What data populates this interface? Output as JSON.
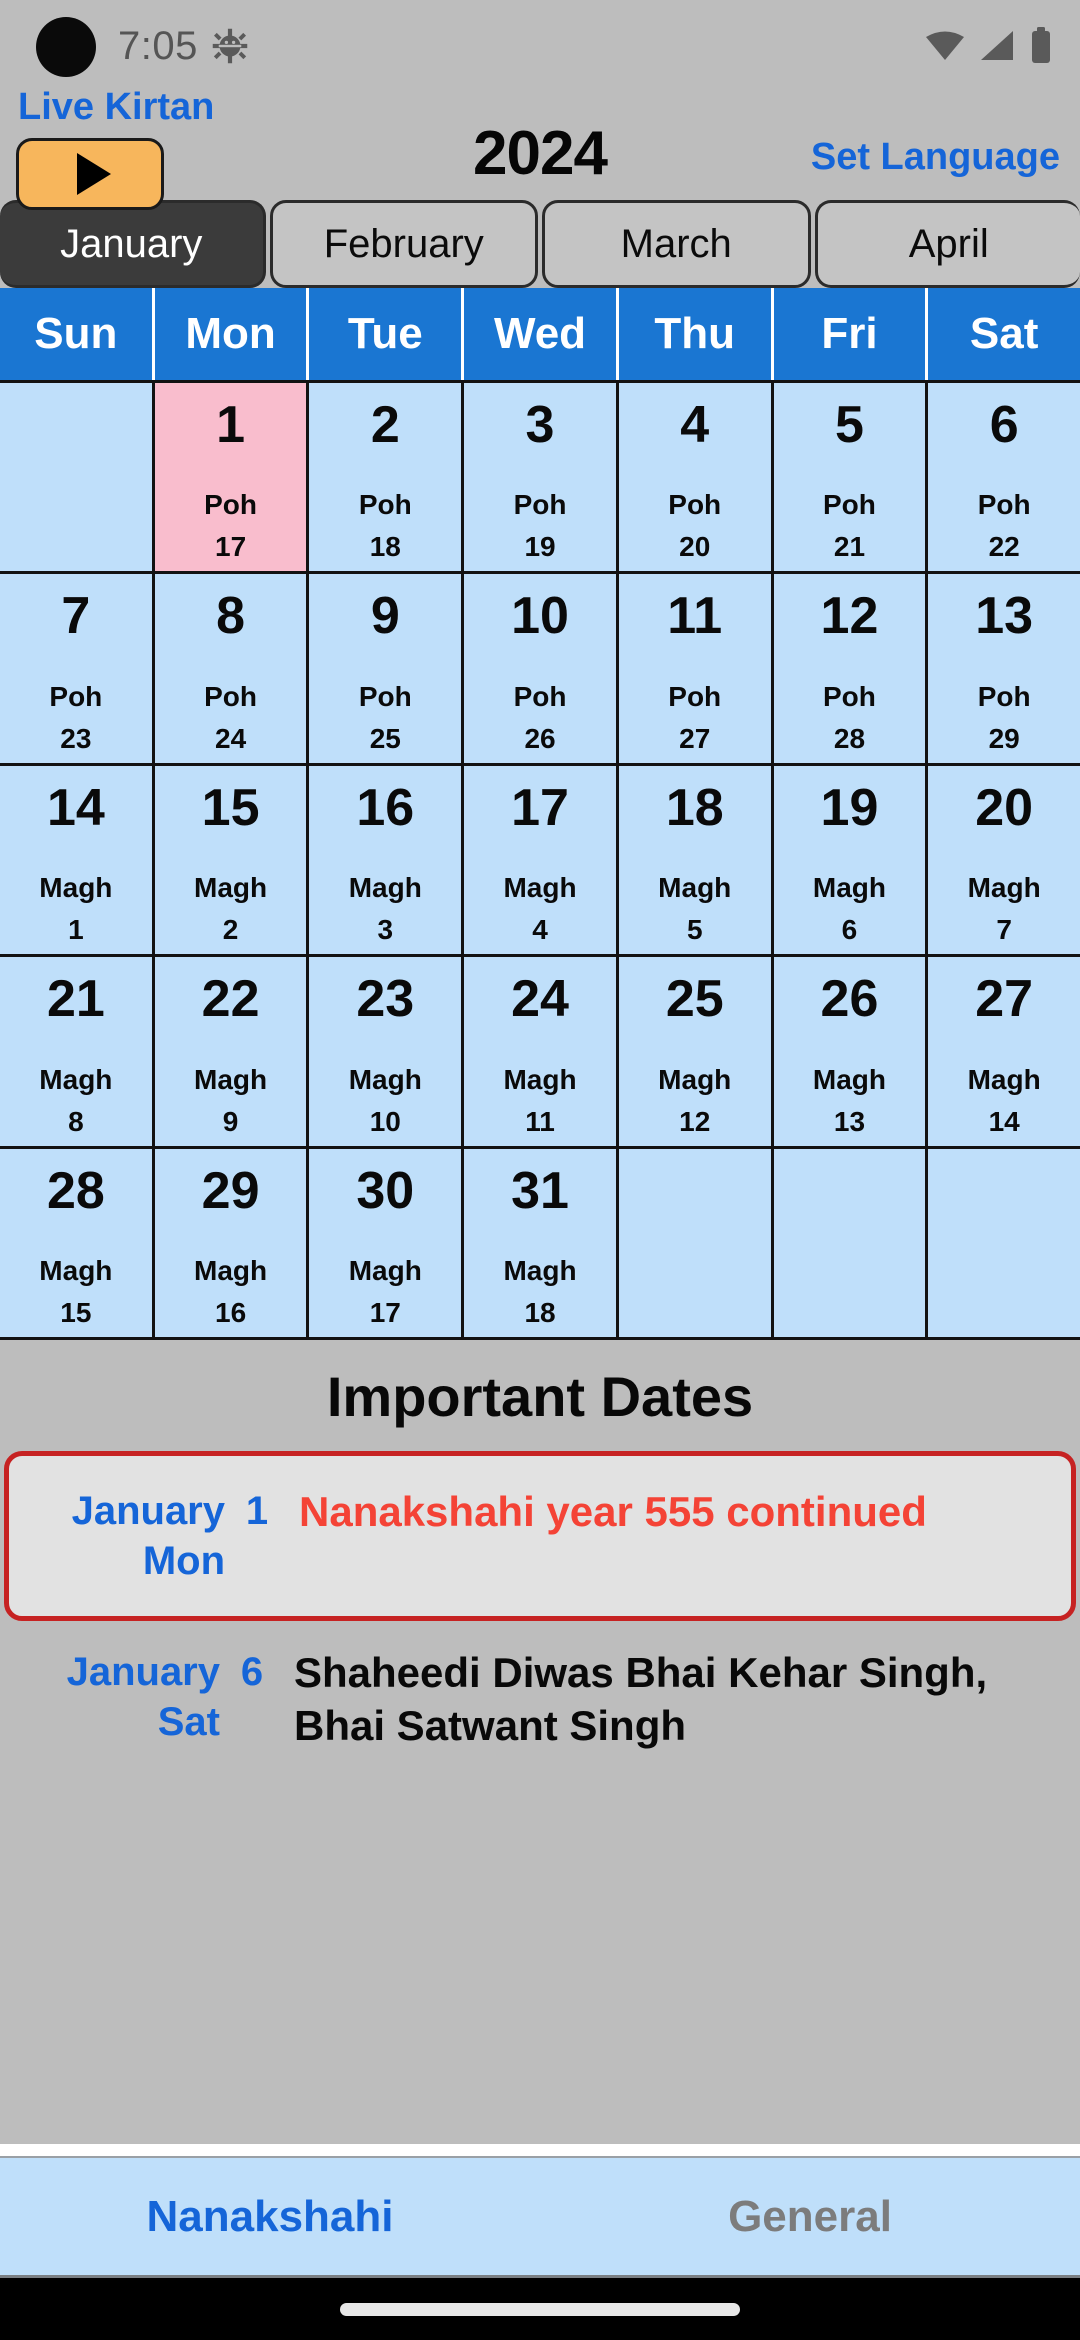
{
  "status_bar": {
    "time": "7:05",
    "icons": [
      "bug-icon",
      "wifi-icon",
      "signal-icon",
      "battery-icon"
    ]
  },
  "header": {
    "live_kirtan_label": "Live Kirtan",
    "play_button": "play-icon",
    "year": "2024",
    "set_language_label": "Set Language"
  },
  "months": [
    {
      "label": "January",
      "selected": true
    },
    {
      "label": "February",
      "selected": false
    },
    {
      "label": "March",
      "selected": false
    },
    {
      "label": "April",
      "selected": false
    }
  ],
  "weekdays": [
    "Sun",
    "Mon",
    "Tue",
    "Wed",
    "Thu",
    "Fri",
    "Sat"
  ],
  "calendar": {
    "month": "January",
    "year": "2024",
    "weeks": [
      [
        {
          "day": "",
          "month_name": "",
          "month_day": "",
          "empty": true
        },
        {
          "day": "1",
          "month_name": "Poh",
          "month_day": "17",
          "highlight": true
        },
        {
          "day": "2",
          "month_name": "Poh",
          "month_day": "18"
        },
        {
          "day": "3",
          "month_name": "Poh",
          "month_day": "19"
        },
        {
          "day": "4",
          "month_name": "Poh",
          "month_day": "20"
        },
        {
          "day": "5",
          "month_name": "Poh",
          "month_day": "21"
        },
        {
          "day": "6",
          "month_name": "Poh",
          "month_day": "22"
        }
      ],
      [
        {
          "day": "7",
          "month_name": "Poh",
          "month_day": "23"
        },
        {
          "day": "8",
          "month_name": "Poh",
          "month_day": "24"
        },
        {
          "day": "9",
          "month_name": "Poh",
          "month_day": "25"
        },
        {
          "day": "10",
          "month_name": "Poh",
          "month_day": "26"
        },
        {
          "day": "11",
          "month_name": "Poh",
          "month_day": "27"
        },
        {
          "day": "12",
          "month_name": "Poh",
          "month_day": "28"
        },
        {
          "day": "13",
          "month_name": "Poh",
          "month_day": "29"
        }
      ],
      [
        {
          "day": "14",
          "month_name": "Magh",
          "month_day": "1"
        },
        {
          "day": "15",
          "month_name": "Magh",
          "month_day": "2"
        },
        {
          "day": "16",
          "month_name": "Magh",
          "month_day": "3"
        },
        {
          "day": "17",
          "month_name": "Magh",
          "month_day": "4"
        },
        {
          "day": "18",
          "month_name": "Magh",
          "month_day": "5"
        },
        {
          "day": "19",
          "month_name": "Magh",
          "month_day": "6"
        },
        {
          "day": "20",
          "month_name": "Magh",
          "month_day": "7"
        }
      ],
      [
        {
          "day": "21",
          "month_name": "Magh",
          "month_day": "8"
        },
        {
          "day": "22",
          "month_name": "Magh",
          "month_day": "9"
        },
        {
          "day": "23",
          "month_name": "Magh",
          "month_day": "10"
        },
        {
          "day": "24",
          "month_name": "Magh",
          "month_day": "11"
        },
        {
          "day": "25",
          "month_name": "Magh",
          "month_day": "12"
        },
        {
          "day": "26",
          "month_name": "Magh",
          "month_day": "13"
        },
        {
          "day": "27",
          "month_name": "Magh",
          "month_day": "14"
        }
      ],
      [
        {
          "day": "28",
          "month_name": "Magh",
          "month_day": "15"
        },
        {
          "day": "29",
          "month_name": "Magh",
          "month_day": "16"
        },
        {
          "day": "30",
          "month_name": "Magh",
          "month_day": "17"
        },
        {
          "day": "31",
          "month_name": "Magh",
          "month_day": "18"
        },
        {
          "day": "",
          "month_name": "",
          "month_day": "",
          "empty": true
        },
        {
          "day": "",
          "month_name": "",
          "month_day": "",
          "empty": true
        },
        {
          "day": "",
          "month_name": "",
          "month_day": "",
          "empty": true
        }
      ]
    ]
  },
  "important_dates": {
    "title": "Important Dates",
    "events": [
      {
        "month": "January",
        "day_number": "1",
        "weekday": "Mon",
        "text": "Nanakshahi year 555 continued",
        "text_color": "red",
        "boxed": true
      },
      {
        "month": "January",
        "day_number": "6",
        "weekday": "Sat",
        "text": "Shaheedi Diwas Bhai Kehar Singh, Bhai Satwant Singh",
        "text_color": "black",
        "boxed": false
      }
    ]
  },
  "bottom_bar": {
    "items": [
      {
        "label": "Nanakshahi",
        "selected": true
      },
      {
        "label": "General",
        "selected": false
      }
    ]
  },
  "colors": {
    "accent_blue": "#1565d8",
    "header_blue": "#1a76d2",
    "cell_blue": "#bfdffa",
    "highlight_pink": "#f9bdcd",
    "play_orange": "#f7b65c",
    "event_red": "#f44336",
    "box_border_red": "#c62222",
    "page_gray": "#bdbdbd"
  }
}
